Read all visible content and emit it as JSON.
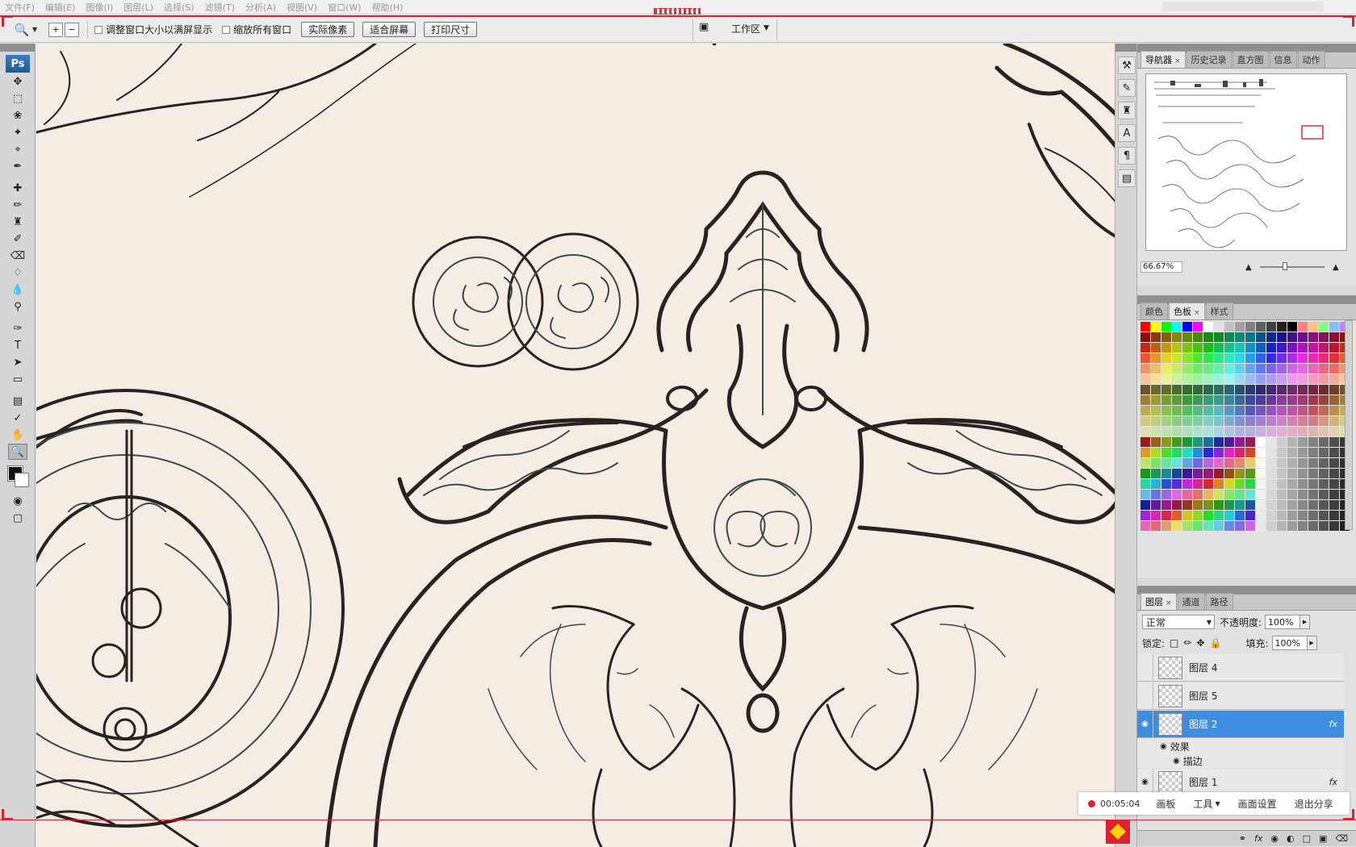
{
  "menubar": {
    "items": [
      "文件(F)",
      "编辑(E)",
      "图像(I)",
      "图层(L)",
      "选择(S)",
      "滤镜(T)",
      "分析(A)",
      "视图(V)",
      "窗口(W)",
      "帮助(H)"
    ]
  },
  "options": {
    "resize_windows_label": "调整窗口大小以满屏显示",
    "zoom_all_label": "缩放所有窗口",
    "actual_pixels": "实际像素",
    "fit_screen": "适合屏幕",
    "print_size": "打印尺寸",
    "workspace": "工作区"
  },
  "toolbox": {
    "logo": "Ps"
  },
  "navigator": {
    "tabs": [
      "导航器",
      "历史记录",
      "直方图",
      "信息",
      "动作"
    ],
    "zoom": "66.67%"
  },
  "swatches": {
    "tabs": [
      "颜色",
      "色板",
      "样式"
    ]
  },
  "layers": {
    "tabs": [
      "图层",
      "通道",
      "路径"
    ],
    "blend_mode": "正常",
    "opacity_label": "不透明度:",
    "opacity": "100%",
    "lock_label": "锁定:",
    "fill_label": "填充:",
    "fill": "100%",
    "items": [
      {
        "name": "图层 4",
        "visible": false,
        "fx": false
      },
      {
        "name": "图层 5",
        "visible": false,
        "fx": false
      },
      {
        "name": "图层 2",
        "visible": true,
        "fx": true,
        "selected": true
      },
      {
        "name": "图层 1",
        "visible": true,
        "fx": true
      }
    ],
    "effects_label": "效果",
    "stroke_label": "描边"
  },
  "recorder": {
    "time": "00:05:04",
    "items": [
      "画板",
      "工具",
      "画面设置",
      "退出分享"
    ]
  },
  "colors": {
    "canvas_bg": "#f5ece4",
    "selected_layer": "#3d8ee0",
    "record_red": "#e02030"
  }
}
